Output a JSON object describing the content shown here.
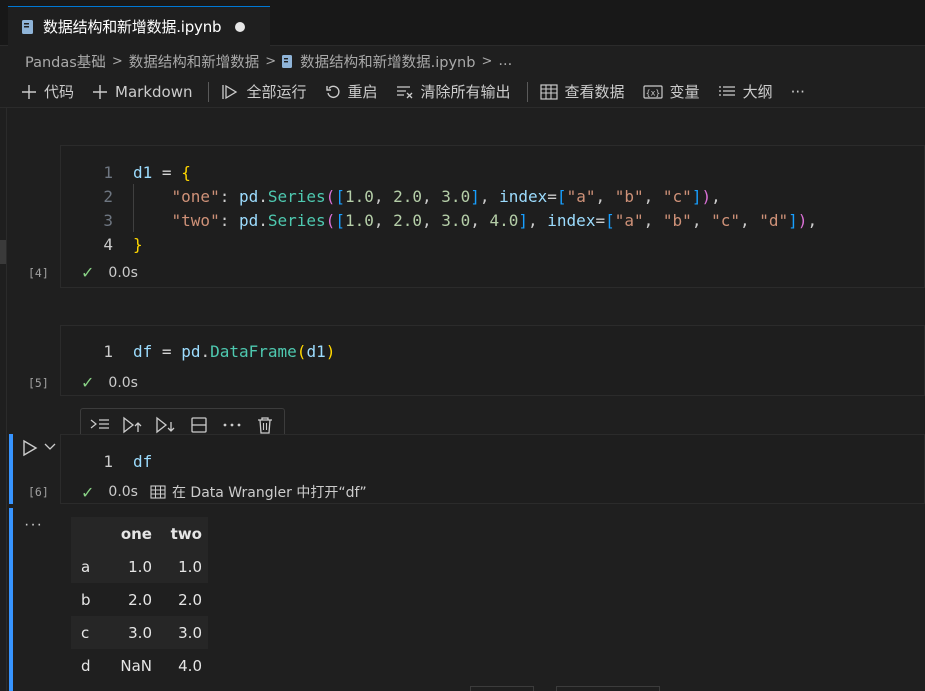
{
  "tab": {
    "title": "数据结构和新增数据.ipynb"
  },
  "breadcrumb": {
    "items": [
      "Pandas基础",
      "数据结构和新增数据",
      "数据结构和新增数据.ipynb",
      "..."
    ]
  },
  "toolbar": {
    "code_label": "代码",
    "markdown_label": "Markdown",
    "run_all_label": "全部运行",
    "restart_label": "重启",
    "clear_outputs_label": "清除所有输出",
    "view_data_label": "查看数据",
    "variables_label": "变量",
    "outline_label": "大纲",
    "more_label": "···"
  },
  "cells": [
    {
      "exec_count": "[4]",
      "status_time": "0.0s",
      "line_numbers": [
        "1",
        "2",
        "3",
        "4"
      ]
    },
    {
      "exec_count": "[5]",
      "status_time": "0.0s",
      "line_numbers": [
        "1"
      ]
    },
    {
      "exec_count": "[6]",
      "status_time": "0.0s",
      "line_numbers": [
        "1"
      ],
      "data_wrangler_link": "在 Data Wrangler 中打开“df”"
    }
  ],
  "output": {
    "more_label": "···",
    "table": {
      "columns": [
        "",
        "one",
        "two"
      ],
      "rows": [
        [
          "a",
          "1.0",
          "1.0"
        ],
        [
          "b",
          "2.0",
          "2.0"
        ],
        [
          "c",
          "3.0",
          "3.0"
        ],
        [
          "d",
          "NaN",
          "4.0"
        ]
      ]
    }
  },
  "colors": {
    "accent": "#3794ff",
    "success": "#89d185",
    "background": "#1f1f1f"
  }
}
